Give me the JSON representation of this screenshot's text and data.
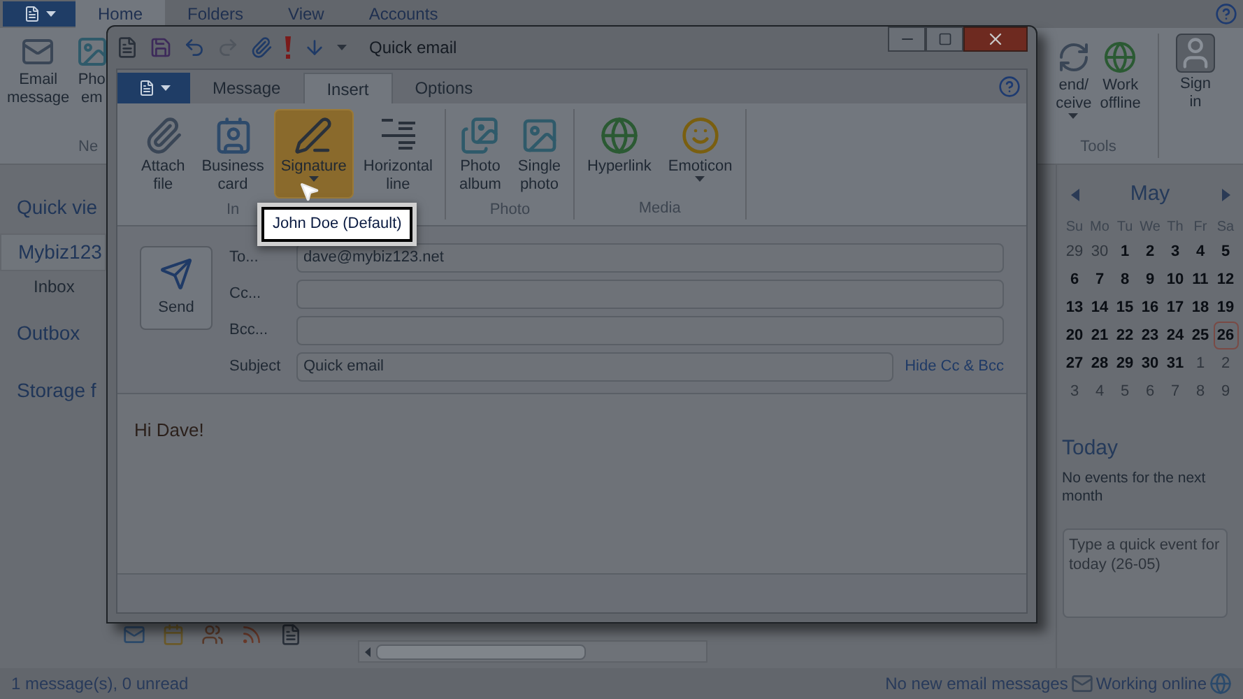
{
  "app": {
    "tabs": [
      {
        "label": "Home",
        "selected": true
      },
      {
        "label": "Folders",
        "selected": false
      },
      {
        "label": "View",
        "selected": false
      },
      {
        "label": "Accounts",
        "selected": false
      }
    ],
    "ribbon_left": [
      {
        "label": "Email\nmessage"
      },
      {
        "label": "Pho\nem"
      }
    ],
    "ribbon_left_group": "Ne",
    "ribbon_right": [
      {
        "label": "end/\nceive",
        "menu": true
      },
      {
        "label": "Work\noffline",
        "menu": false
      }
    ],
    "ribbon_right_group": "Tools",
    "ribbon_sign_in": {
      "label": "Sign\nin"
    },
    "sidebar": [
      {
        "label": "Quick vie",
        "kind": "heading"
      },
      {
        "label": "Mybiz123",
        "kind": "account"
      },
      {
        "label": "Inbox",
        "kind": "folder"
      },
      {
        "label": "Outbox",
        "kind": "heading"
      },
      {
        "label": "Storage f",
        "kind": "heading"
      }
    ],
    "calendar": {
      "month": "May",
      "weekdays": [
        "Su",
        "Mo",
        "Tu",
        "We",
        "Th",
        "Fr",
        "Sa"
      ],
      "days": [
        {
          "label": "29",
          "other_month": true,
          "selected": false
        },
        {
          "label": "30",
          "other_month": true,
          "selected": false
        },
        {
          "label": "1",
          "other_month": false,
          "selected": false
        },
        {
          "label": "2",
          "other_month": false,
          "selected": false
        },
        {
          "label": "3",
          "other_month": false,
          "selected": false
        },
        {
          "label": "4",
          "other_month": false,
          "selected": false
        },
        {
          "label": "5",
          "other_month": false,
          "selected": false
        },
        {
          "label": "6",
          "other_month": false,
          "selected": false
        },
        {
          "label": "7",
          "other_month": false,
          "selected": false
        },
        {
          "label": "8",
          "other_month": false,
          "selected": false
        },
        {
          "label": "9",
          "other_month": false,
          "selected": false
        },
        {
          "label": "10",
          "other_month": false,
          "selected": false
        },
        {
          "label": "11",
          "other_month": false,
          "selected": false
        },
        {
          "label": "12",
          "other_month": false,
          "selected": false
        },
        {
          "label": "13",
          "other_month": false,
          "selected": false
        },
        {
          "label": "14",
          "other_month": false,
          "selected": false
        },
        {
          "label": "15",
          "other_month": false,
          "selected": false
        },
        {
          "label": "16",
          "other_month": false,
          "selected": false
        },
        {
          "label": "17",
          "other_month": false,
          "selected": false
        },
        {
          "label": "18",
          "other_month": false,
          "selected": false
        },
        {
          "label": "19",
          "other_month": false,
          "selected": false
        },
        {
          "label": "20",
          "other_month": false,
          "selected": false
        },
        {
          "label": "21",
          "other_month": false,
          "selected": false
        },
        {
          "label": "22",
          "other_month": false,
          "selected": false
        },
        {
          "label": "23",
          "other_month": false,
          "selected": false
        },
        {
          "label": "24",
          "other_month": false,
          "selected": false
        },
        {
          "label": "25",
          "other_month": false,
          "selected": false
        },
        {
          "label": "26",
          "other_month": false,
          "selected": true
        },
        {
          "label": "27",
          "other_month": false,
          "selected": false
        },
        {
          "label": "28",
          "other_month": false,
          "selected": false
        },
        {
          "label": "29",
          "other_month": false,
          "selected": false
        },
        {
          "label": "30",
          "other_month": false,
          "selected": false
        },
        {
          "label": "31",
          "other_month": false,
          "selected": false
        },
        {
          "label": "1",
          "other_month": true,
          "selected": false
        },
        {
          "label": "2",
          "other_month": true,
          "selected": false
        },
        {
          "label": "3",
          "other_month": true,
          "selected": false
        },
        {
          "label": "4",
          "other_month": true,
          "selected": false
        },
        {
          "label": "5",
          "other_month": true,
          "selected": false
        },
        {
          "label": "6",
          "other_month": true,
          "selected": false
        },
        {
          "label": "7",
          "other_month": true,
          "selected": false
        },
        {
          "label": "8",
          "other_month": true,
          "selected": false
        },
        {
          "label": "9",
          "other_month": true,
          "selected": false
        }
      ]
    },
    "today": {
      "title": "Today",
      "text": "No events for the next month",
      "placeholder": "Type a quick event for today (26-05)"
    },
    "status_bar": {
      "left": "1 message(s), 0 unread",
      "mail_status": "No new email messages",
      "connection": "Working online"
    }
  },
  "compose": {
    "title": "Quick email",
    "tabs": [
      {
        "label": "Message",
        "selected": false
      },
      {
        "label": "Insert",
        "selected": true
      },
      {
        "label": "Options",
        "selected": false
      }
    ],
    "groups": [
      {
        "label": "In",
        "buttons": [
          {
            "label": "Attach\nfile",
            "menu": false,
            "highlighted": false
          },
          {
            "label": "Business\ncard",
            "menu": false,
            "highlighted": false
          },
          {
            "label": "Signature",
            "menu": true,
            "highlighted": true
          },
          {
            "label": "Horizontal\nline",
            "menu": false,
            "highlighted": false
          }
        ]
      },
      {
        "label": "Photo",
        "buttons": [
          {
            "label": "Photo\nalbum",
            "menu": false,
            "highlighted": false
          },
          {
            "label": "Single\nphoto",
            "menu": false,
            "highlighted": false
          }
        ]
      },
      {
        "label": "Media",
        "buttons": [
          {
            "label": "Hyperlink",
            "menu": false,
            "highlighted": false
          },
          {
            "label": "Emoticon",
            "menu": true,
            "highlighted": false
          }
        ]
      }
    ],
    "signature_menu": [
      {
        "label": "John Doe (Default)",
        "selected": true
      }
    ],
    "send": "Send",
    "fields": [
      {
        "label": "To...",
        "value": "dave@mybiz123.net"
      },
      {
        "label": "Cc..."
      },
      {
        "label": "Bcc..."
      }
    ],
    "subject": {
      "label": "Subject",
      "value": "Quick email"
    },
    "hide_link": "Hide Cc & Bcc",
    "body": "Hi Dave!"
  }
}
